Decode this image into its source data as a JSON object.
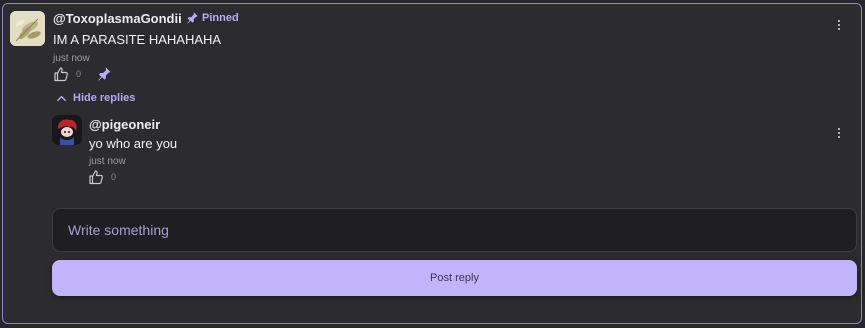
{
  "colors": {
    "accent": "#b4aaf0",
    "button_bg": "#c1b4fb",
    "panel_bg": "#2b2b30",
    "border": "#8c86c6"
  },
  "comment": {
    "username": "@ToxoplasmaGondii",
    "pinned_label": "Pinned",
    "text": "IM A PARASITE HAHAHAHA",
    "timestamp": "just now",
    "likes": "0",
    "avatar_icon": "wheat-avatar",
    "like_icon": "thumbs-up-icon",
    "pin_icon": "pin-icon",
    "menu_icon": "kebab-menu-icon"
  },
  "replies_toggle": {
    "label": "Hide replies",
    "icon": "chevron-up-icon"
  },
  "replies": [
    {
      "username": "@pigeoneir",
      "text": "yo who are you",
      "timestamp": "just now",
      "likes": "0",
      "avatar_icon": "red-haired-character-avatar",
      "like_icon": "thumbs-up-icon",
      "menu_icon": "kebab-menu-icon"
    }
  ],
  "composer": {
    "placeholder": "Write something",
    "value": "",
    "submit_label": "Post reply"
  }
}
